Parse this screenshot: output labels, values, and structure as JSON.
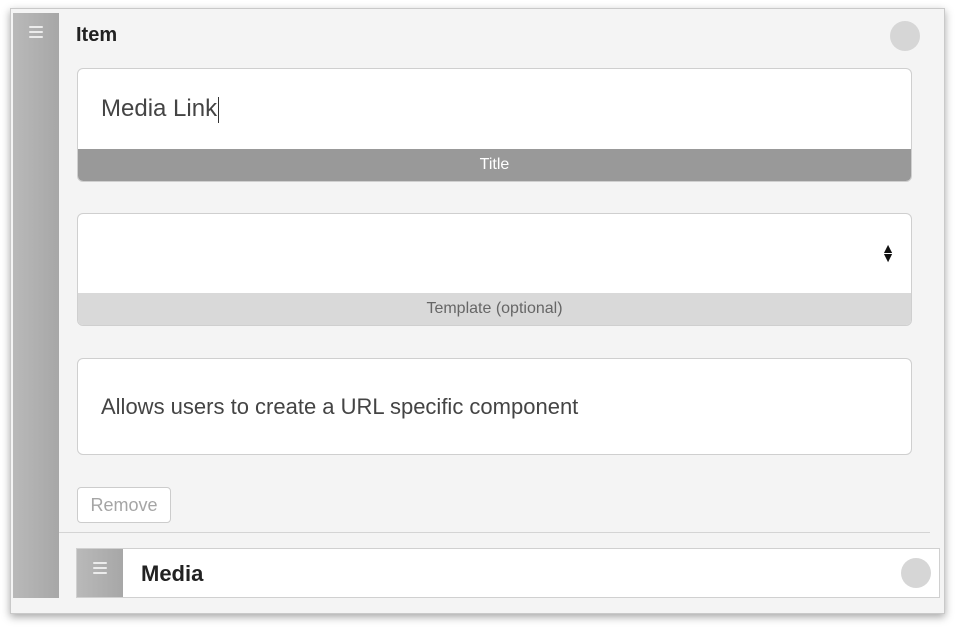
{
  "item": {
    "title": "Item",
    "fields": {
      "title_value": "Media Link",
      "title_label": "Title",
      "template_value": "",
      "template_label": "Template (optional)",
      "description": "Allows users to create a URL specific component"
    },
    "remove_label": "Remove"
  },
  "child": {
    "title": "Media"
  },
  "icons": {
    "handle": "drag-handle-icon",
    "status": "status-dot-icon",
    "select": "select-arrows-icon"
  },
  "colors": {
    "label_dark": "#999999",
    "label_light": "#d9d9d9",
    "handle": "#b0b0b0",
    "status_dot": "#d6d6d6"
  }
}
